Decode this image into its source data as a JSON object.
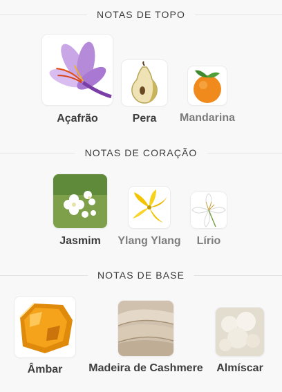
{
  "sections": {
    "top": {
      "heading": "NOTAS DE TOPO",
      "notes": [
        {
          "label": "Açafrão",
          "icon": "saffron-flower-icon"
        },
        {
          "label": "Pera",
          "icon": "pear-icon"
        },
        {
          "label": "Mandarina",
          "icon": "mandarin-icon"
        }
      ]
    },
    "heart": {
      "heading": "NOTAS DE CORAÇÃO",
      "notes": [
        {
          "label": "Jasmim",
          "icon": "jasmine-icon"
        },
        {
          "label": "Ylang Ylang",
          "icon": "ylang-ylang-icon"
        },
        {
          "label": "Lírio",
          "icon": "lily-icon"
        }
      ]
    },
    "base": {
      "heading": "NOTAS DE BASE",
      "notes": [
        {
          "label": "Âmbar",
          "icon": "amber-icon"
        },
        {
          "label": "Madeira de Cashmere",
          "icon": "cashmere-wood-icon"
        },
        {
          "label": "Almíscar",
          "icon": "musk-icon"
        }
      ]
    }
  },
  "colors": {
    "background": "#f8f8f8",
    "label": "#3e3e3e",
    "muted_label": "#7d7d7d",
    "divider": "#e4e4e4"
  }
}
